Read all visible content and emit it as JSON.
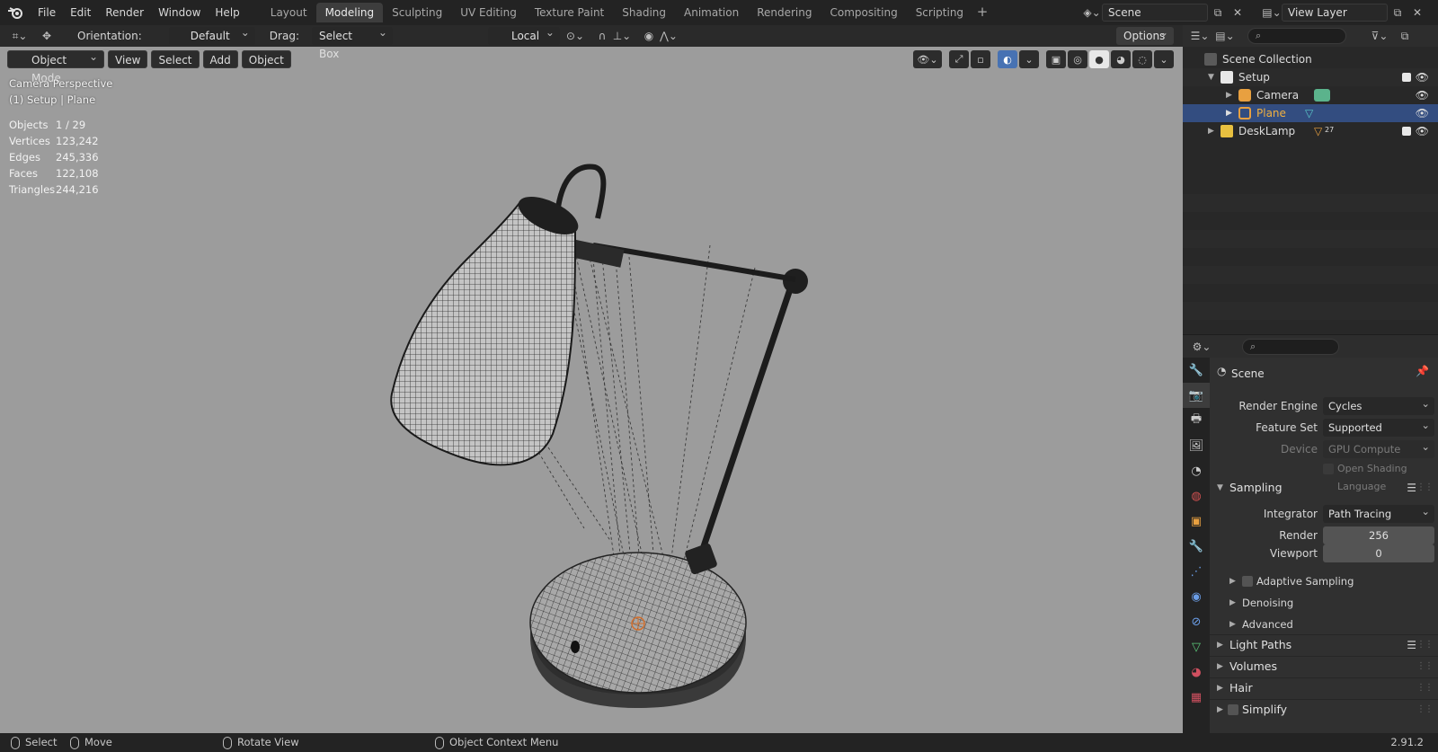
{
  "menu": [
    "File",
    "Edit",
    "Render",
    "Window",
    "Help"
  ],
  "workspaces": [
    "Layout",
    "Modeling",
    "Sculpting",
    "UV Editing",
    "Texture Paint",
    "Shading",
    "Animation",
    "Rendering",
    "Compositing",
    "Scripting"
  ],
  "active_workspace": "Modeling",
  "scene_name": "Scene",
  "view_layer": "View Layer",
  "toolbar": {
    "orientation_label": "Orientation:",
    "orientation_value": "Default",
    "drag_label": "Drag:",
    "drag_value": "Select Box",
    "transform_pivot": "Local",
    "options_label": "Options"
  },
  "viewport_header": {
    "mode": "Object Mode",
    "buttons": [
      "View",
      "Select",
      "Add",
      "Object"
    ]
  },
  "overlay": {
    "camera_text": "Camera Perspective",
    "context_text": "(1) Setup | Plane",
    "stats": [
      {
        "label": "Objects",
        "value": "1 / 29"
      },
      {
        "label": "Vertices",
        "value": "123,242"
      },
      {
        "label": "Edges",
        "value": "245,336"
      },
      {
        "label": "Faces",
        "value": "122,108"
      },
      {
        "label": "Triangles",
        "value": "244,216"
      }
    ]
  },
  "outliner": {
    "root": "Scene Collection",
    "items": [
      {
        "name": "Setup"
      },
      {
        "name": "Camera"
      },
      {
        "name": "Plane"
      },
      {
        "name": "DeskLamp",
        "badge": "27"
      }
    ]
  },
  "properties": {
    "context": "Scene",
    "render_engine_label": "Render Engine",
    "render_engine": "Cycles",
    "feature_set_label": "Feature Set",
    "feature_set": "Supported",
    "device_label": "Device",
    "device": "GPU Compute",
    "osl_label": "Open Shading Language",
    "sampling_label": "Sampling",
    "integrator_label": "Integrator",
    "integrator": "Path Tracing",
    "render_label": "Render",
    "render_samples": "256",
    "viewport_label": "Viewport",
    "viewport_samples": "0",
    "adaptive_label": "Adaptive Sampling",
    "denoising_label": "Denoising",
    "advanced_label": "Advanced",
    "light_paths_label": "Light Paths",
    "volumes_label": "Volumes",
    "hair_label": "Hair",
    "simplify_label": "Simplify"
  },
  "statusbar": {
    "select": "Select",
    "move": "Move",
    "rotate": "Rotate View",
    "context_menu": "Object Context Menu",
    "version": "2.91.2"
  },
  "colors": {
    "accent": "#4772b3",
    "selected_row": "#334d80",
    "viewport_bg": "#9c9c9c",
    "camera_icon": "#5bb38c",
    "mesh_icon": "#e8a040",
    "collection_icon": "#e8e8e8"
  }
}
